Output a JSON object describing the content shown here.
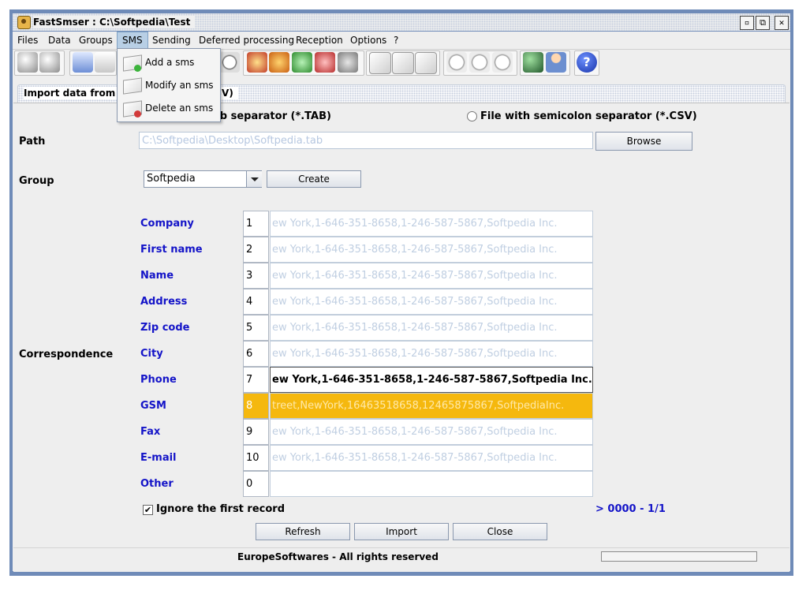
{
  "window": {
    "title": "FastSmser : C:\\Softpedia\\Test"
  },
  "menu": [
    "Files",
    "Data",
    "Groups",
    "SMS",
    "Sending",
    "Deferred processing",
    "Reception",
    "Options",
    "?"
  ],
  "sms_menu": [
    "Add a sms",
    "Modify an sms",
    "Delete an sms"
  ],
  "panel": {
    "title": "Import data from a file (*.TAB or *.CSV)"
  },
  "radios": {
    "tab_label": "File with tab separator (*.TAB)",
    "tab_visible": "ab separator (*.TAB)",
    "csv_label": "File with semicolon separator (*.CSV)"
  },
  "path": {
    "label": "Path",
    "value": "C:\\Softpedia\\Desktop\\Softpedia.tab",
    "browse": "Browse"
  },
  "group": {
    "label": "Group",
    "value": "Softpedia",
    "create": "Create"
  },
  "correspondence": {
    "label": "Correspondence",
    "rows": [
      {
        "field": "Company",
        "col": "1",
        "data": "ew York,1-646-351-8658,1-246-587-5867,Softpedia Inc."
      },
      {
        "field": "First name",
        "col": "2",
        "data": "ew York,1-646-351-8658,1-246-587-5867,Softpedia Inc."
      },
      {
        "field": "Name",
        "col": "3",
        "data": "ew York,1-646-351-8658,1-246-587-5867,Softpedia Inc."
      },
      {
        "field": "Address",
        "col": "4",
        "data": "ew York,1-646-351-8658,1-246-587-5867,Softpedia Inc."
      },
      {
        "field": "Zip code",
        "col": "5",
        "data": "ew York,1-646-351-8658,1-246-587-5867,Softpedia Inc."
      },
      {
        "field": "City",
        "col": "6",
        "data": "ew York,1-646-351-8658,1-246-587-5867,Softpedia Inc."
      },
      {
        "field": "Phone",
        "col": "7",
        "data": "ew York,1-646-351-8658,1-246-587-5867,Softpedia Inc."
      },
      {
        "field": "GSM",
        "col": "8",
        "data": "treet,NewYork,16463518658,12465875867,SoftpediaInc."
      },
      {
        "field": "Fax",
        "col": "9",
        "data": "ew York,1-646-351-8658,1-246-587-5867,Softpedia Inc."
      },
      {
        "field": "E-mail",
        "col": "10",
        "data": "ew York,1-646-351-8658,1-246-587-5867,Softpedia Inc."
      },
      {
        "field": "Other",
        "col": "0",
        "data": ""
      }
    ]
  },
  "options": {
    "ignore_first": "Ignore the first record",
    "ignore_checked": true,
    "record_counter": "> 0000 - 1/1"
  },
  "buttons": {
    "refresh": "Refresh",
    "import": "Import",
    "close": "Close"
  },
  "footer": {
    "copyright": "EuropeSoftwares - All rights reserved"
  },
  "window_buttons": {
    "minimize": "▫",
    "maximize": "⧉",
    "close": "✕"
  },
  "colors": {
    "frame": "#6f8bb8",
    "field_label": "#1414c8",
    "selection": "#f5b80e",
    "counter": "#1414c8"
  }
}
